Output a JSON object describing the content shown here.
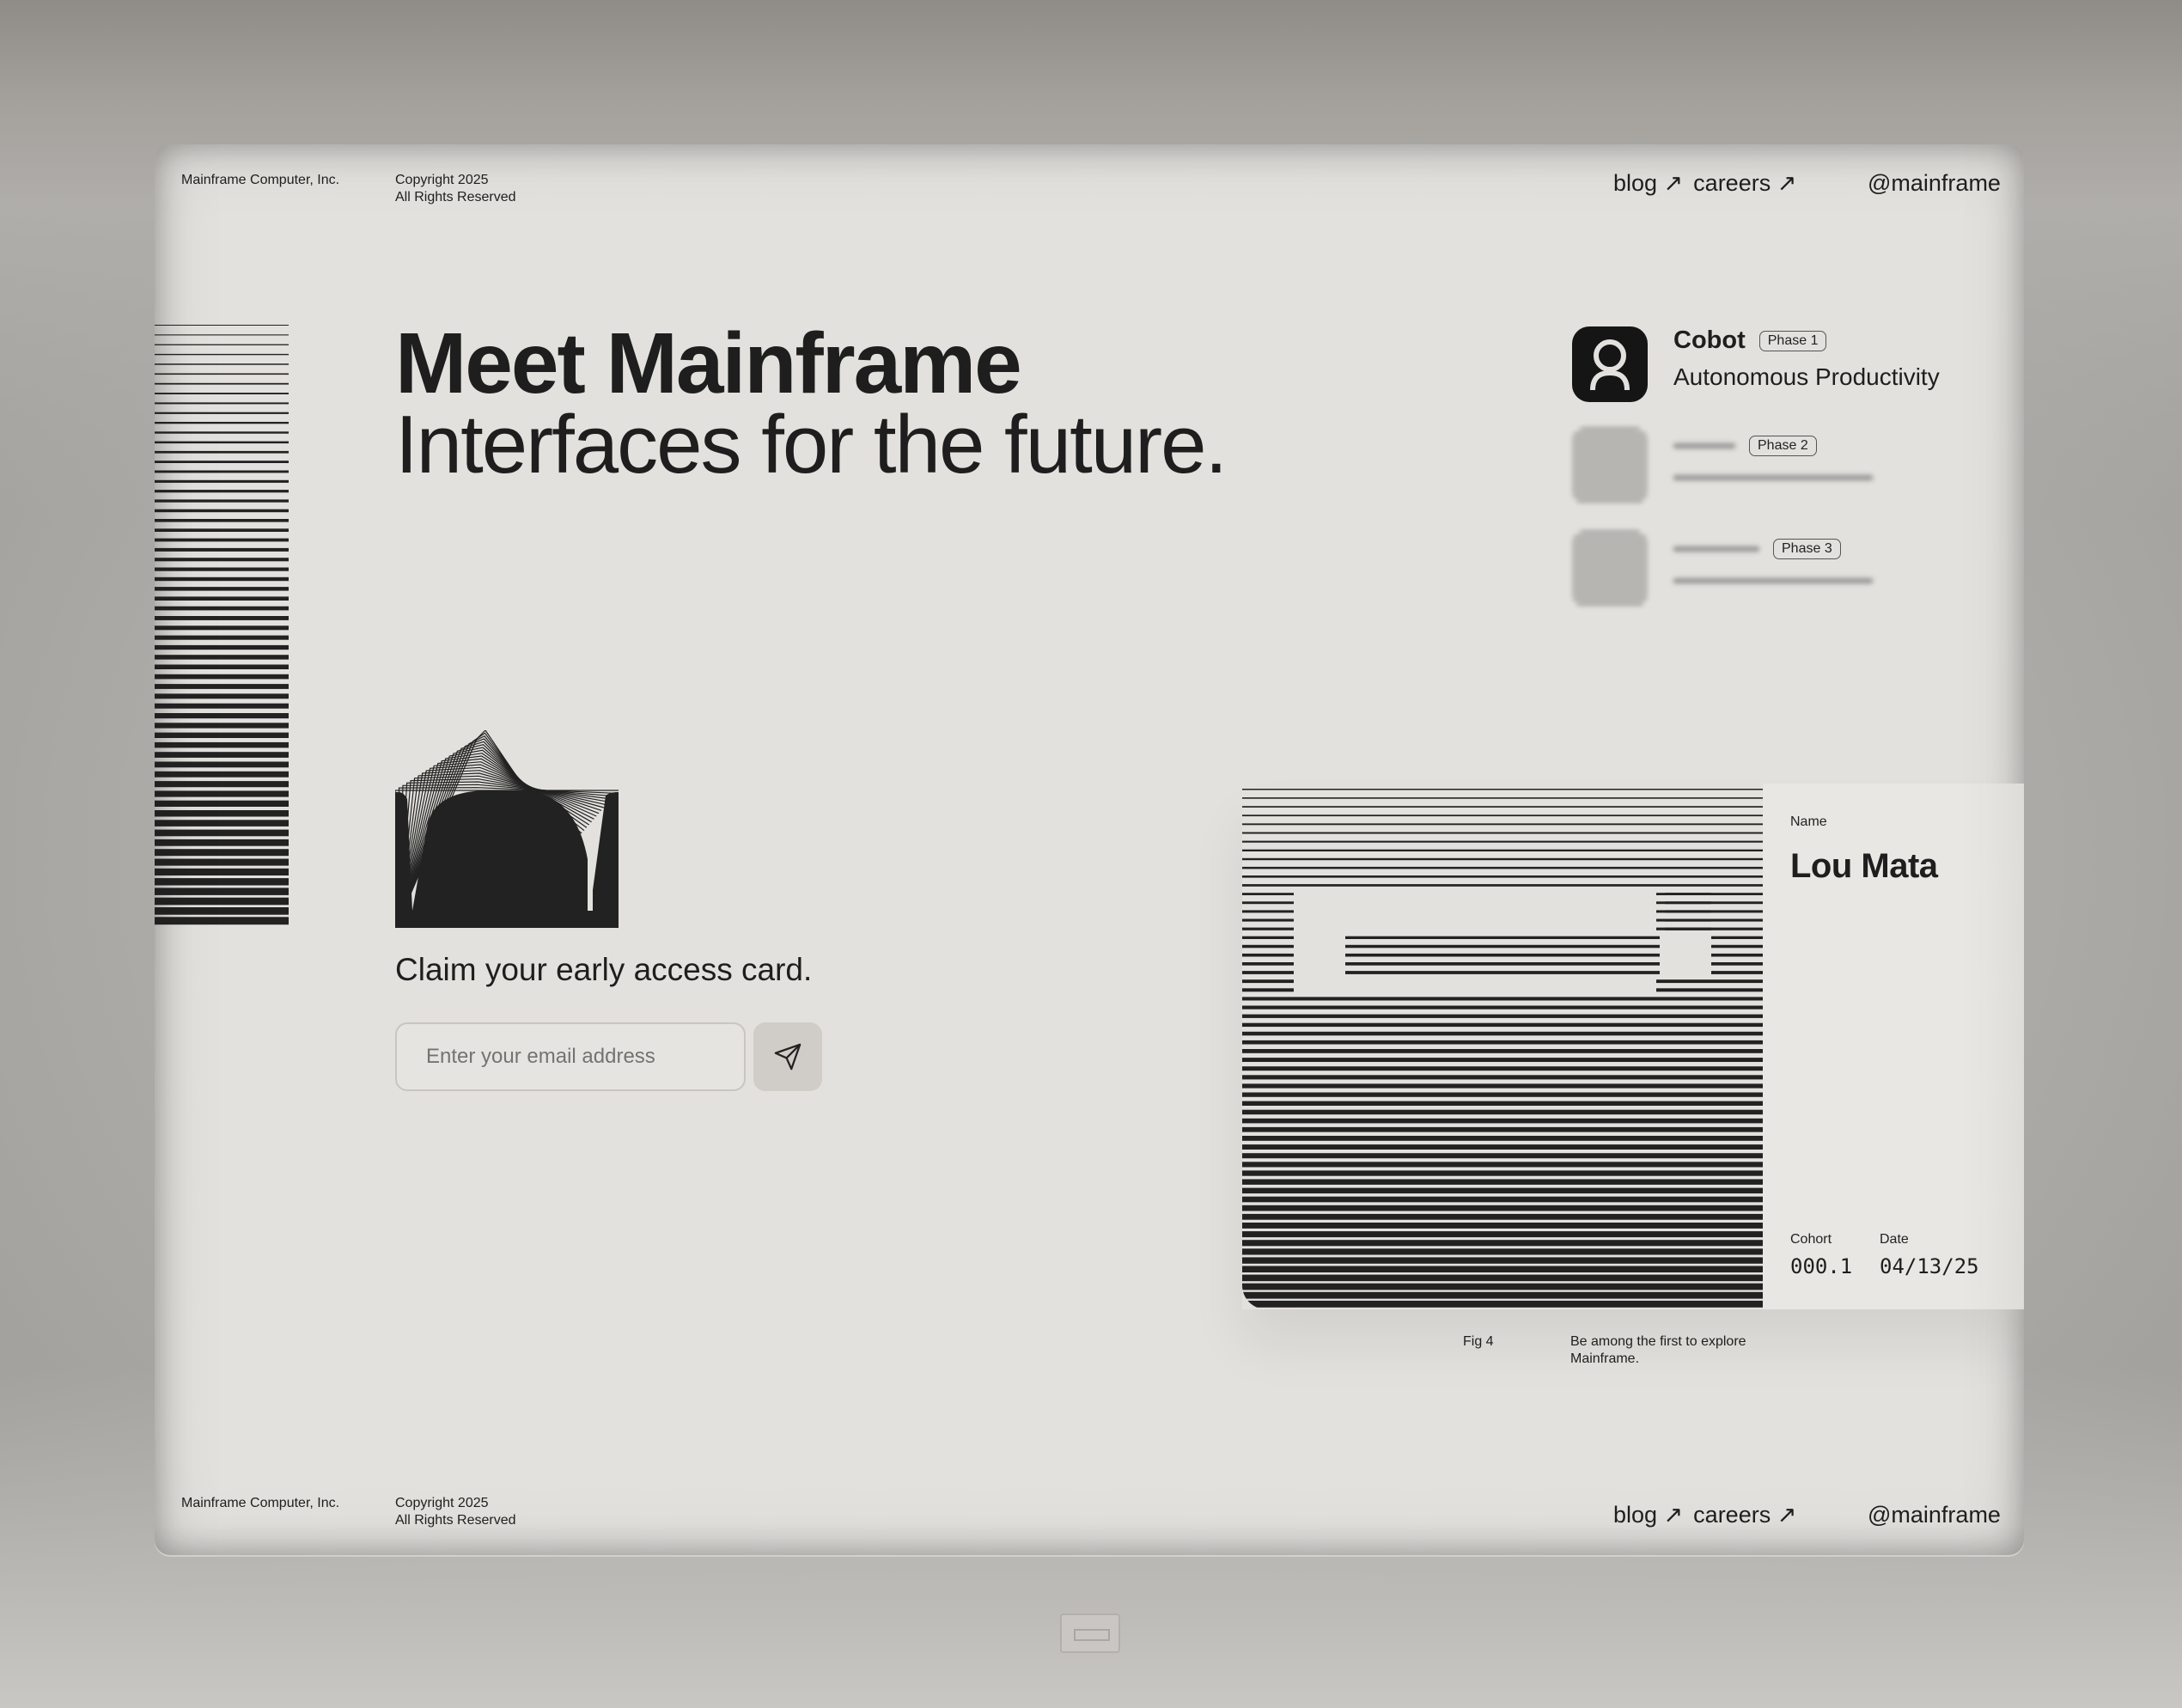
{
  "header": {
    "company": "Mainframe Computer, Inc.",
    "copyright_line1": "Copyright 2025",
    "copyright_line2": "All Rights Reserved",
    "nav": [
      {
        "label": "blog ↗"
      },
      {
        "label": "careers ↗"
      }
    ],
    "handle": "@mainframe"
  },
  "hero": {
    "title": "Meet Mainframe",
    "subtitle": "Interfaces for the future."
  },
  "products": [
    {
      "name": "Cobot",
      "phase": "Phase 1",
      "description": "Autonomous Productivity",
      "icon": "person-icon"
    },
    {
      "name": "",
      "phase": "Phase 2",
      "description": "",
      "icon": "blurred-icon"
    },
    {
      "name": "",
      "phase": "Phase 3",
      "description": "",
      "icon": "blurred-icon"
    }
  ],
  "signup": {
    "heading": "Claim your early access card.",
    "email_placeholder": "Enter your email address",
    "submit_icon": "send-icon"
  },
  "card": {
    "name_label": "Name",
    "name_value": "Lou Mata",
    "cohort_label": "Cohort",
    "cohort_value": "000.1",
    "date_label": "Date",
    "date_value": "04/13/25"
  },
  "figure": {
    "label": "Fig 4",
    "caption_line1": "Be among the first to explore",
    "caption_line2": "Mainframe."
  },
  "footer": {
    "company": "Mainframe Computer, Inc.",
    "copyright_line1": "Copyright 2025",
    "copyright_line2": "All Rights Reserved",
    "nav": [
      {
        "label": "blog ↗"
      },
      {
        "label": "careers ↗"
      }
    ],
    "handle": "@mainframe"
  },
  "colors": {
    "screen_bg": "#e3e1dd",
    "ink": "#1e1e1e",
    "bezel": "#a9a7a3"
  }
}
